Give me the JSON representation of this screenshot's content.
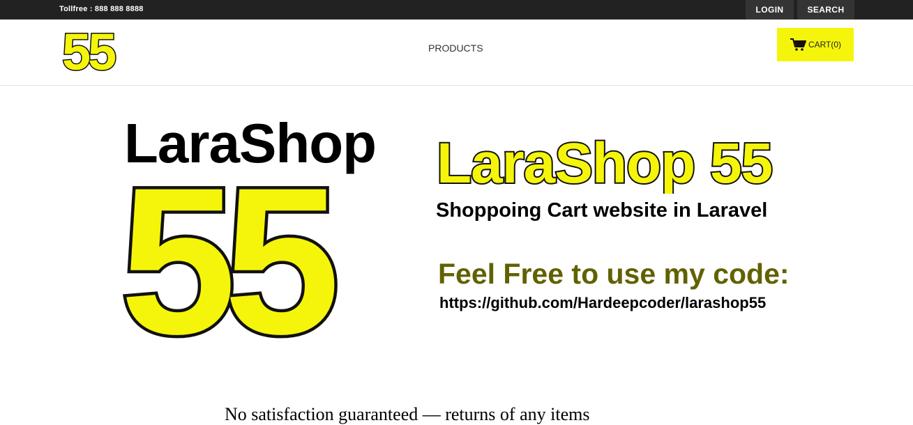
{
  "topbar": {
    "tollfree": "Tollfree : 888 888 8888",
    "login_label": "LOGIN",
    "search_label": "SEARCH"
  },
  "header": {
    "logo_text": "55",
    "nav_products": "PRODUCTS",
    "cart_label": "CART(0)",
    "cart_icon": "shopping-cart-icon"
  },
  "hero": {
    "brand_text": "LaraShop",
    "brand_number": "55",
    "title": "LaraShop 55",
    "subtitle": "Shoppoing Cart website in Laravel",
    "free_text": "Feel Free to use my code:",
    "url": "https://github.com/Hardeepcoder/larashop55"
  },
  "bottom_text": "No satisfaction guaranteed — returns of any items",
  "colors": {
    "brand_yellow": "#f5f50b",
    "topbar_bg": "#222222",
    "olive": "#626100"
  }
}
